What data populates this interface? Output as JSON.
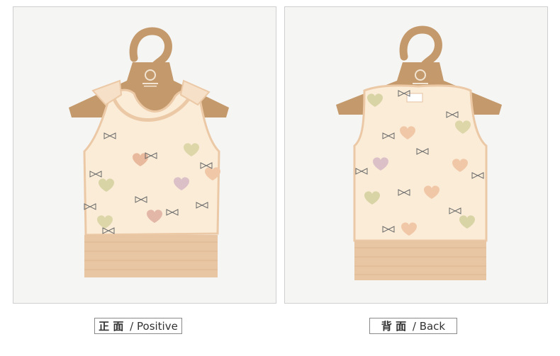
{
  "views": [
    {
      "id": "front",
      "caption_cn": "正 面",
      "caption_sep": " / ",
      "caption_en": "Positive"
    },
    {
      "id": "back",
      "caption_cn": "背 面",
      "caption_sep": " / ",
      "caption_en": "Back"
    }
  ],
  "colors": {
    "page_bg": "#ffffff",
    "panel_bg": "#f5f5f4",
    "hanger": "#c49a6c",
    "vest_body": "#fbecd7",
    "vest_trim": "#ecc9a6",
    "hem_band": "#e9c6a3",
    "print_hearts": [
      "#e8b99c",
      "#d9d4a5",
      "#dcc0c8",
      "#f0c8a8"
    ],
    "print_bows": "#6a6a6a"
  },
  "icons": [
    "hanger-icon",
    "brand-logo-icon",
    "heart-print-icon",
    "bow-print-icon"
  ]
}
